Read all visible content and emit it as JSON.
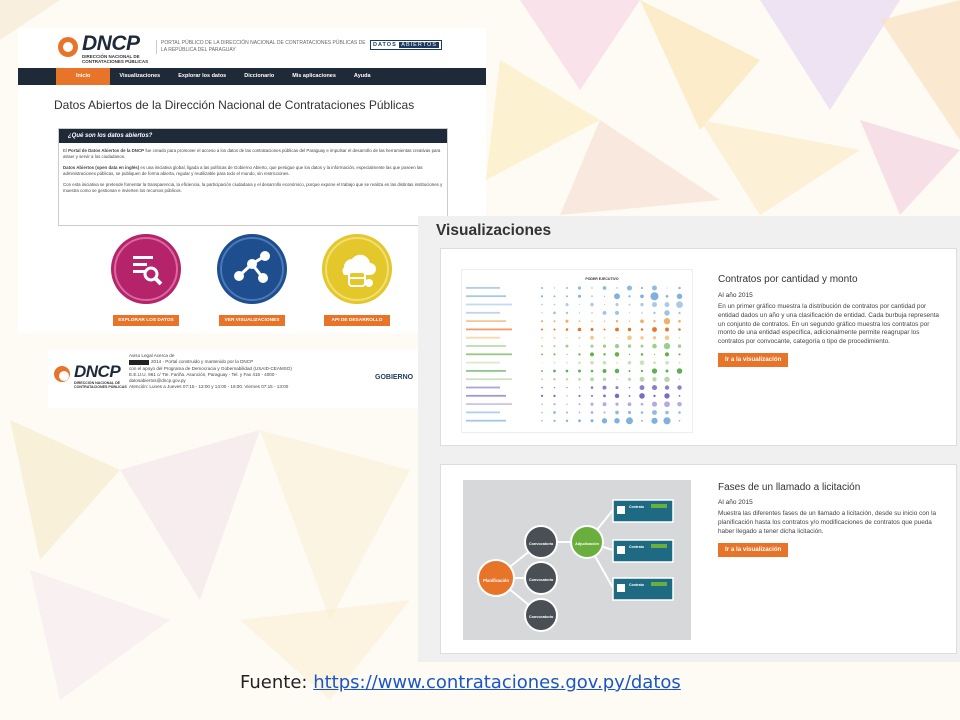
{
  "portal": {
    "logo_text": "DNCP",
    "logo_sub": "DIRECCIÓN NACIONAL DE CONTRATACIONES PÚBLICAS",
    "header_text": "PORTAL PÚBLICO DE LA DIRECCIÓN NACIONAL DE CONTRATACIONES PÚBLICAS DE LA REPÚBLICA DEL PARAGUAY",
    "badge_left": "DATOS",
    "badge_right": "ABIERTOS",
    "nav": [
      "Inicio",
      "Visualizaciones",
      "Explorar los datos",
      "Diccionario",
      "Mis aplicaciones",
      "Ayuda"
    ],
    "title": "Datos Abiertos de la Dirección Nacional de Contrataciones Públicas",
    "box_heading": "¿Qué son los datos abiertos?",
    "p1_bold": "Portal de Datos Abiertos de la DNCP",
    "p1_start": "El ",
    "p1_rest": " fue creado para promover el acceso a los datos de las contrataciones públicas del Paraguay e impulsar el desarrollo de las herramientas creativas para atraer y servir a los ciudadanos.",
    "p2_bold": "Datos Abiertos (open data en inglés)",
    "p2_rest": " es una iniciativa global, ligada a las políticas de Gobierno Abierto, que persigue que los datos y la información, especialmente las que poseen las administraciones públicas, se publiquen de forma abierta, regular y reutilizable para todo el mundo, sin restricciones.",
    "p3": "Con esta iniciativa se pretende fomentar la transparencia, la eficiencia, la participación ciudadana y el desarrollo económico, porque expone el trabajo que se realiza en las distintas instituciones y muestra como se gestionan e invierten los recursos públicos.",
    "buttons": [
      "EXPLORAR LOS DATOS",
      "VER VISUALIZACIONES",
      "API DE DESARROLLO"
    ],
    "colors": {
      "accent": "#e8742a",
      "nav": "#1e2a38",
      "magenta": "#b5236a",
      "blue": "#1f4e8f",
      "yellow": "#e4c72a"
    }
  },
  "footer": {
    "logo_text": "DNCP",
    "logo_sub": "DIRECCIÓN NACIONAL DE CONTRATACIONES PÚBLICAS",
    "lines": [
      "Aviso Legal Acerca de",
      "2014 - Portal construido y mantenido por la DNCP",
      "con el apoyo del Programa de Democracia y Gobernabilidad (USAID-CEAMSO)",
      "E.E.U.U. 961 c/ Tte. Fariña. Asunción, Paraguay - Tel. y Fax 415 - 4000 -",
      "datosabiertos@dncp.gov.py",
      "Atención: Lunes a Jueves 07:15 - 13:00 y 14:00 - 16:00. Viernes 07:15 - 13:00"
    ],
    "gob": "GOBIERNO"
  },
  "visualizations": {
    "title": "Visualizaciones",
    "card1": {
      "heading": "Contratos por cantidad y monto",
      "year": "Al año 2015",
      "desc": "En un primer gráfico muestra la distribución de contratos por cantidad por entidad dados un año y una clasificación de entidad. Cada burbuja representa un conjunto de contratos. En un segundo gráfico muestra los contratos por monto de una entidad específica, adicionalmente permite reagrupar los contratos por convocante, categoría o tipo de procedimiento.",
      "button": "Ir a la visualización",
      "chart_header": "PODER EJECUTIVO"
    },
    "card2": {
      "heading": "Fases de un llamado a licitación",
      "year": "Al año 2015",
      "desc": "Muestra las diferentes fases de un llamado a licitación, desde su inicio con la planificación hasta los contratos y/o modificaciones de contratos que pueda haber llegado a tener dicha licitación.",
      "button": "Ir a la visualización",
      "nodes": {
        "planning": "Planificación",
        "call": "Convocatoria",
        "award": "Adjudicación",
        "contract": "Contrato"
      }
    }
  },
  "caption": {
    "prefix": "Fuente: ",
    "link": "https://www.contrataciones.gov.py/datos"
  }
}
